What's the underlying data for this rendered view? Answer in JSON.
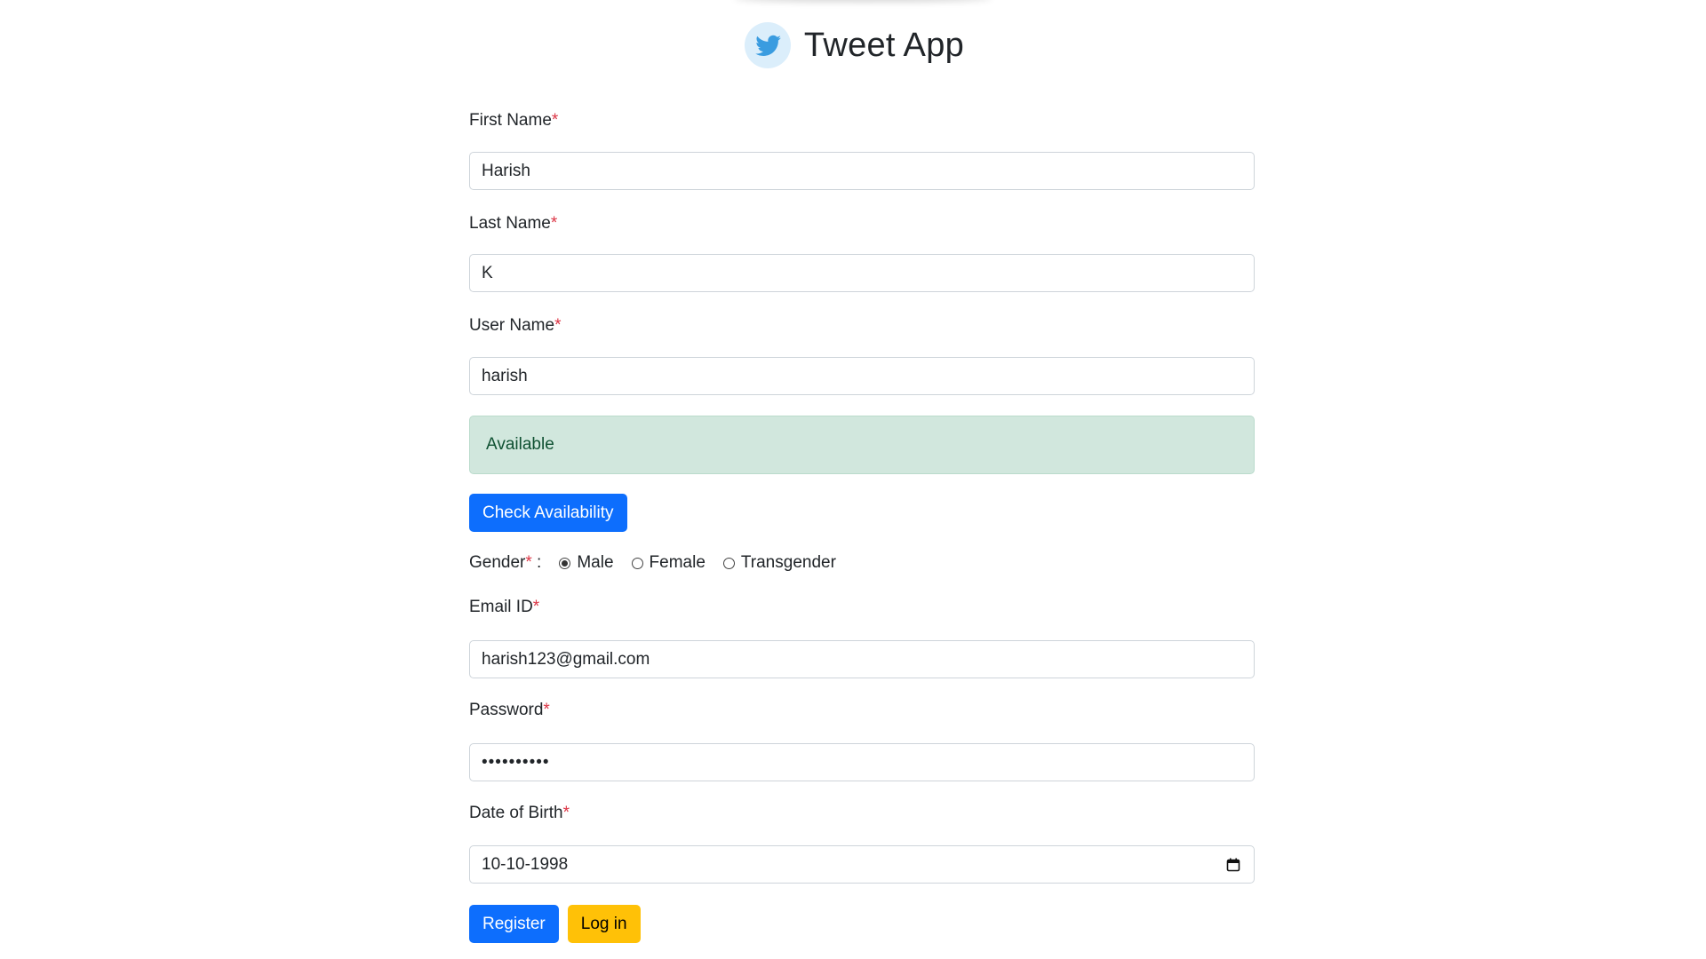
{
  "header": {
    "title": "Tweet App",
    "logo_icon": "twitter-bird-icon"
  },
  "colors": {
    "primary": "#0d6efd",
    "warning": "#ffc107",
    "success_bg": "#d1e7dd",
    "success_text": "#0f5132",
    "required": "#dc3545"
  },
  "form": {
    "required_marker": "*",
    "first_name": {
      "label": "First Name",
      "value": "Harish"
    },
    "last_name": {
      "label": "Last Name",
      "value": "K"
    },
    "user_name": {
      "label": "User Name",
      "value": "harish"
    },
    "availability_alert": "Available",
    "check_availability_label": "Check Availability",
    "gender": {
      "label": "Gender",
      "separator": " :",
      "options": [
        "Male",
        "Female",
        "Transgender"
      ],
      "selected": "Male"
    },
    "email": {
      "label": "Email ID",
      "value": "harish123@gmail.com"
    },
    "password": {
      "label": "Password",
      "value": "••••••••••"
    },
    "dob": {
      "label": "Date of Birth",
      "value": "10-10-1998",
      "icon": "calendar-icon"
    },
    "register_label": "Register",
    "login_label": "Log in"
  }
}
